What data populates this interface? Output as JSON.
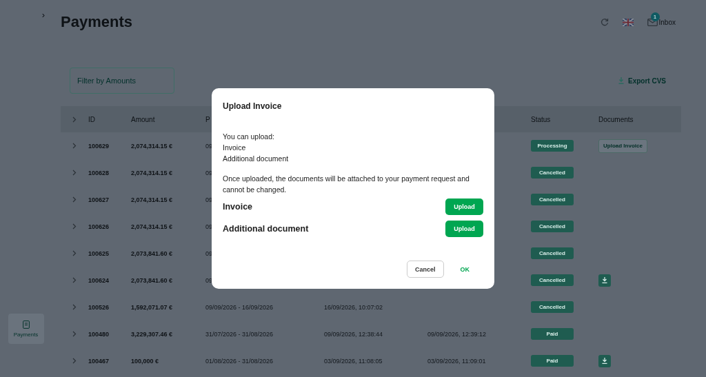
{
  "sidebar": {
    "toggle": "›",
    "items": [
      {
        "label": "Payments",
        "selected": true
      }
    ]
  },
  "header": {
    "title": "Payments",
    "badge": "1",
    "inbox": "Inbox"
  },
  "filter": {
    "placeholder": "Filter by Amounts"
  },
  "export": {
    "label": "Export CVS"
  },
  "table": {
    "columns": [
      {
        "label": "ID"
      },
      {
        "label": "Amount"
      },
      {
        "label": "P"
      },
      {},
      {},
      {
        "label": "Status"
      },
      {
        "label": "Documents"
      }
    ],
    "rows": [
      {
        "id": "100629",
        "amount": "2,074,314.15 €",
        "period": "09",
        "status": "Processing",
        "document": {
          "kind": "upload",
          "label": "Upload Invoice"
        }
      },
      {
        "id": "100628",
        "amount": "2,074,314.15 €",
        "period": "09",
        "status": "Cancelled"
      },
      {
        "id": "100627",
        "amount": "2,074,314.15 €",
        "period": "09",
        "status": "Cancelled"
      },
      {
        "id": "100626",
        "amount": "2,074,314.15 €",
        "period": "09",
        "status": "Cancelled"
      },
      {
        "id": "100625",
        "amount": "2,073,841.60 €",
        "period": "09",
        "status": "Cancelled"
      },
      {
        "id": "100624",
        "amount": "2,073,841.60 €",
        "period": "09",
        "status": "Cancelled",
        "document": {
          "kind": "download"
        }
      },
      {
        "id": "100526",
        "amount": "1,592,071.07 €",
        "period": "09/09/2026 - 16/09/2026",
        "created": "16/09/2026, 10:07:02",
        "status": "Cancelled"
      },
      {
        "id": "100480",
        "amount": "3,229,307.46 €",
        "period": "31/07/2026 - 31/08/2026",
        "created": "09/09/2026, 12:38:44",
        "paid": "09/09/2026, 12:39:12",
        "status": "Paid"
      },
      {
        "id": "100467",
        "amount": "100,000 €",
        "period": "01/08/2026 - 31/08/2026",
        "created": "03/09/2026, 11:08:05",
        "paid": "03/09/2026, 11:09:01",
        "status": "Paid",
        "document": {
          "kind": "download"
        }
      }
    ]
  },
  "modal": {
    "title": "Upload Invoice",
    "intro_lines": [
      "You can upload:",
      "Invoice",
      "Additional document"
    ],
    "note": "Once uploaded, the documents will be attached to your payment request and cannot be changed.",
    "uploads": [
      {
        "label": "Invoice",
        "button": "Upload"
      },
      {
        "label": "Additional document",
        "button": "Upload"
      }
    ],
    "buttons": [
      {
        "label": "Cancel",
        "kind": "secondary"
      },
      {
        "label": "OK",
        "kind": "primary"
      }
    ]
  }
}
